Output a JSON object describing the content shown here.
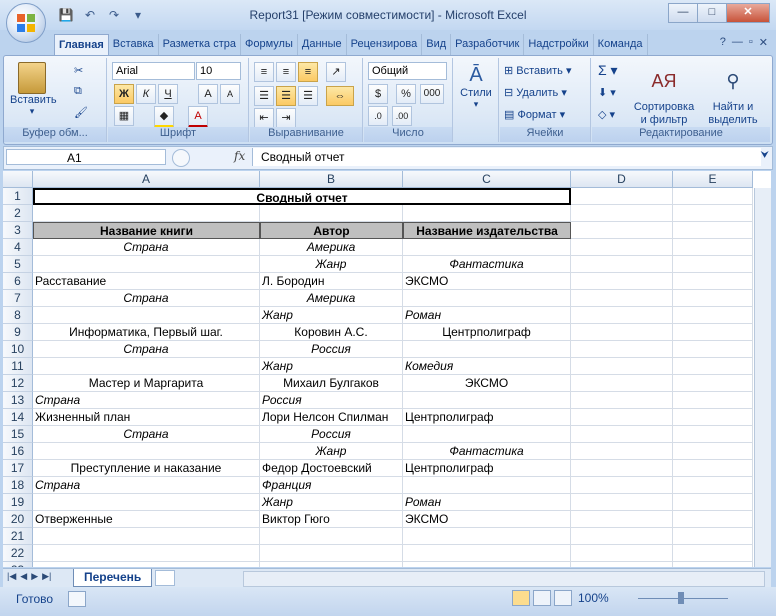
{
  "window": {
    "title": "Report31  [Режим совместимости] - Microsoft Excel",
    "minimize": "—",
    "maximize": "□",
    "close": "✕"
  },
  "ribbon_tabs": [
    "Главная",
    "Вставка",
    "Разметка стра",
    "Формулы",
    "Данные",
    "Рецензирова",
    "Вид",
    "Разработчик",
    "Надстройки",
    "Команда"
  ],
  "ribbon": {
    "clipboard": {
      "paste": "Вставить",
      "label": "Буфер обм..."
    },
    "font": {
      "name": "Arial",
      "size": "10",
      "bold": "Ж",
      "italic": "К",
      "underline": "Ч",
      "label": "Шрифт"
    },
    "alignment": {
      "label": "Выравнивание"
    },
    "number": {
      "format": "Общий",
      "label": "Число"
    },
    "styles": {
      "button": "Стили"
    },
    "cells": {
      "insert": "Вставить",
      "delete": "Удалить",
      "format": "Формат",
      "label": "Ячейки"
    },
    "editing": {
      "sort": "Сортировка\nи фильтр",
      "find": "Найти и\nвыделить",
      "label": "Редактирование"
    }
  },
  "formula_bar": {
    "name_box": "A1",
    "fx": "fx",
    "content": "Сводный отчет"
  },
  "columns": [
    "A",
    "B",
    "C",
    "D",
    "E"
  ],
  "rows": [
    {
      "n": "1",
      "a": "Сводный отчет",
      "b": "",
      "c": ""
    },
    {
      "n": "2",
      "a": "",
      "b": "",
      "c": ""
    },
    {
      "n": "3",
      "a": "Название книги",
      "b": "Автор",
      "c": "Название издательства"
    },
    {
      "n": "4",
      "a": "Страна",
      "b": "Америка",
      "c": ""
    },
    {
      "n": "5",
      "a": "",
      "b": "Жанр",
      "c": "Фантастика"
    },
    {
      "n": "6",
      "a": "Расставание",
      "b": "Л. Бородин",
      "c": "ЭКСМО"
    },
    {
      "n": "7",
      "a": "Страна",
      "b": "Америка",
      "c": ""
    },
    {
      "n": "8",
      "a": "",
      "b": "Жанр",
      "c": "Роман"
    },
    {
      "n": "9",
      "a": "Информатика, Первый шаг.",
      "b": "Коровин А.С.",
      "c": "Центрполиграф"
    },
    {
      "n": "10",
      "a": "Страна",
      "b": "Россия",
      "c": ""
    },
    {
      "n": "11",
      "a": "",
      "b": "Жанр",
      "c": "Комедия"
    },
    {
      "n": "12",
      "a": "Мастер и Маргарита",
      "b": "Михаил Булгаков",
      "c": "ЭКСМО"
    },
    {
      "n": "13",
      "a": "Страна",
      "b": "Россия",
      "c": ""
    },
    {
      "n": "14",
      "a": "Жизненный план",
      "b": "Лори Нелсон Спилман",
      "c": "Центрполиграф"
    },
    {
      "n": "15",
      "a": "Страна",
      "b": "Россия",
      "c": ""
    },
    {
      "n": "16",
      "a": "",
      "b": "Жанр",
      "c": "Фантастика"
    },
    {
      "n": "17",
      "a": "Преступление и наказание",
      "b": "Федор Достоевский",
      "c": "Центрполиграф"
    },
    {
      "n": "18",
      "a": "Страна",
      "b": "Франция",
      "c": ""
    },
    {
      "n": "19",
      "a": "",
      "b": "Жанр",
      "c": "Роман"
    },
    {
      "n": "20",
      "a": "Отверженные",
      "b": "Виктор Гюго",
      "c": "ЭКСМО"
    },
    {
      "n": "21",
      "a": "",
      "b": "",
      "c": ""
    },
    {
      "n": "22",
      "a": "",
      "b": "",
      "c": ""
    },
    {
      "n": "23",
      "a": "",
      "b": "",
      "c": ""
    }
  ],
  "sheet": {
    "tab": "Перечень"
  },
  "status": {
    "ready": "Готово",
    "zoom": "100%"
  }
}
